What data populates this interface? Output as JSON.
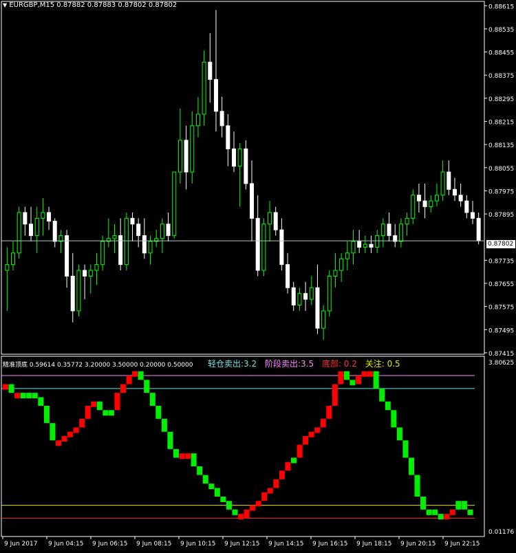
{
  "window": {
    "symbol_info": "EURGBP,M15  0.87882 0.87883 0.87802 0.87802",
    "menu_icon": "triangle-down-icon"
  },
  "colors": {
    "background": "#000000",
    "axis": "#ffffff",
    "bull": "#00ff00",
    "bear": "#ffffff",
    "last_price_line": "#a9c8c8",
    "ind_red": "#ff0000",
    "ind_green": "#00ee00",
    "level_pink": "#ff88ff",
    "level_cyan": "#6ee0e0",
    "level_yellow": "#e8e800",
    "level_red": "#ff3030"
  },
  "price_axis": {
    "labels": [
      "0.88615",
      "0.88535",
      "0.88455",
      "0.88375",
      "0.88295",
      "0.88215",
      "0.88135",
      "0.88055",
      "0.87975",
      "0.87895",
      "0.87802",
      "0.87735",
      "0.87655",
      "0.87575",
      "0.87495",
      "0.87415"
    ],
    "last_price": "0.87802",
    "range": [
      0.8741,
      0.8863
    ]
  },
  "time_axis": {
    "labels": [
      "9 Jun 2017",
      "9 Jun 04:15",
      "9 Jun 06:15",
      "9 Jun 08:15",
      "9 Jun 10:15",
      "9 Jun 12:15",
      "9 Jun 14:15",
      "9 Jun 16:15",
      "9 Jun 18:15",
      "9 Jun 20:15",
      "9 Jun 22:15"
    ]
  },
  "indicator": {
    "title": "精准顶底 0.59614 0.35772 3.20000 3.50000 0.20000 0.50000",
    "legend": [
      {
        "text": "轻仓卖出:3.2",
        "color": "#6ee0e0"
      },
      {
        "text": "阶段卖出:3.5",
        "color": "#ff88ff"
      },
      {
        "text": "底部: 0.2",
        "color": "#ff3030"
      },
      {
        "text": "关注: 0.5",
        "color": "#e8e800"
      }
    ],
    "axis_top": "3.80625",
    "axis_bottom": "0.01176",
    "levels": [
      3.5,
      3.2,
      0.5,
      0.2
    ],
    "range": [
      0.0,
      3.85
    ]
  },
  "chart_data": {
    "type": "candlestick",
    "symbol": "EURGBP",
    "timeframe": "M15",
    "candles": [
      [
        0.877,
        0.8778,
        0.8756,
        0.8772
      ],
      [
        0.8772,
        0.878,
        0.877,
        0.8776
      ],
      [
        0.8776,
        0.8792,
        0.8774,
        0.879
      ],
      [
        0.879,
        0.8792,
        0.8782,
        0.8786
      ],
      [
        0.8786,
        0.8792,
        0.878,
        0.8782
      ],
      [
        0.8782,
        0.8792,
        0.8776,
        0.8788
      ],
      [
        0.8788,
        0.8795,
        0.8782,
        0.879
      ],
      [
        0.879,
        0.8792,
        0.8784,
        0.8787
      ],
      [
        0.8787,
        0.8788,
        0.8778,
        0.878
      ],
      [
        0.878,
        0.8784,
        0.8776,
        0.8782
      ],
      [
        0.8782,
        0.8784,
        0.8764,
        0.8768
      ],
      [
        0.8768,
        0.8776,
        0.8752,
        0.8756
      ],
      [
        0.8756,
        0.8772,
        0.8754,
        0.877
      ],
      [
        0.877,
        0.8772,
        0.876,
        0.8768
      ],
      [
        0.8768,
        0.8772,
        0.8762,
        0.877
      ],
      [
        0.877,
        0.8776,
        0.8765,
        0.8772
      ],
      [
        0.8772,
        0.8782,
        0.877,
        0.878
      ],
      [
        0.878,
        0.8788,
        0.8778,
        0.8781
      ],
      [
        0.8781,
        0.8786,
        0.8776,
        0.8782
      ],
      [
        0.8782,
        0.8788,
        0.877,
        0.8772
      ],
      [
        0.8772,
        0.879,
        0.877,
        0.8788
      ],
      [
        0.8788,
        0.879,
        0.878,
        0.8786
      ],
      [
        0.8786,
        0.8788,
        0.8778,
        0.8782
      ],
      [
        0.8782,
        0.8788,
        0.8774,
        0.8776
      ],
      [
        0.8776,
        0.8782,
        0.8772,
        0.878
      ],
      [
        0.878,
        0.8784,
        0.8778,
        0.8781
      ],
      [
        0.8781,
        0.8788,
        0.8776,
        0.8786
      ],
      [
        0.8786,
        0.879,
        0.878,
        0.8782
      ],
      [
        0.8782,
        0.88,
        0.8781,
        0.8804
      ],
      [
        0.8804,
        0.8826,
        0.88,
        0.8815
      ],
      [
        0.8815,
        0.882,
        0.8798,
        0.8804
      ],
      [
        0.8804,
        0.8825,
        0.88,
        0.882
      ],
      [
        0.882,
        0.883,
        0.8816,
        0.8824
      ],
      [
        0.8824,
        0.8846,
        0.882,
        0.8842
      ],
      [
        0.8842,
        0.8852,
        0.8828,
        0.8836
      ],
      [
        0.8836,
        0.886,
        0.8818,
        0.8825
      ],
      [
        0.8825,
        0.883,
        0.8816,
        0.882
      ],
      [
        0.882,
        0.8824,
        0.8806,
        0.8812
      ],
      [
        0.8812,
        0.8818,
        0.8804,
        0.8806
      ],
      [
        0.8806,
        0.8814,
        0.8792,
        0.8812
      ],
      [
        0.8812,
        0.8815,
        0.8798,
        0.88
      ],
      [
        0.88,
        0.8808,
        0.878,
        0.8788
      ],
      [
        0.8788,
        0.8796,
        0.8768,
        0.877
      ],
      [
        0.877,
        0.8788,
        0.8768,
        0.8786
      ],
      [
        0.8786,
        0.8794,
        0.878,
        0.879
      ],
      [
        0.879,
        0.8792,
        0.8782,
        0.8784
      ],
      [
        0.8784,
        0.8788,
        0.877,
        0.8772
      ],
      [
        0.8772,
        0.8776,
        0.8762,
        0.8764
      ],
      [
        0.8764,
        0.8766,
        0.8756,
        0.8758
      ],
      [
        0.8758,
        0.8764,
        0.8756,
        0.8762
      ],
      [
        0.8762,
        0.8766,
        0.8756,
        0.876
      ],
      [
        0.876,
        0.8768,
        0.8758,
        0.8764
      ],
      [
        0.8764,
        0.8772,
        0.8748,
        0.875
      ],
      [
        0.875,
        0.8758,
        0.8746,
        0.8756
      ],
      [
        0.8756,
        0.877,
        0.8754,
        0.8768
      ],
      [
        0.8768,
        0.8776,
        0.8764,
        0.877
      ],
      [
        0.877,
        0.8776,
        0.8766,
        0.8774
      ],
      [
        0.8774,
        0.878,
        0.877,
        0.8776
      ],
      [
        0.8776,
        0.8784,
        0.8772,
        0.878
      ],
      [
        0.878,
        0.8784,
        0.8776,
        0.8778
      ],
      [
        0.8778,
        0.8782,
        0.8776,
        0.8779
      ],
      [
        0.8779,
        0.8782,
        0.8776,
        0.8778
      ],
      [
        0.8778,
        0.8784,
        0.8776,
        0.8782
      ],
      [
        0.8782,
        0.8788,
        0.8778,
        0.8786
      ],
      [
        0.8786,
        0.879,
        0.878,
        0.8782
      ],
      [
        0.8782,
        0.8786,
        0.8778,
        0.878
      ],
      [
        0.878,
        0.8788,
        0.8778,
        0.8786
      ],
      [
        0.8786,
        0.879,
        0.8782,
        0.8788
      ],
      [
        0.8788,
        0.8798,
        0.8786,
        0.8796
      ],
      [
        0.8796,
        0.88,
        0.879,
        0.8794
      ],
      [
        0.8794,
        0.88,
        0.8788,
        0.8792
      ],
      [
        0.8792,
        0.8796,
        0.879,
        0.8794
      ],
      [
        0.8794,
        0.88,
        0.8792,
        0.8796
      ],
      [
        0.8796,
        0.8808,
        0.8794,
        0.8804
      ],
      [
        0.8804,
        0.8808,
        0.8796,
        0.8798
      ],
      [
        0.8798,
        0.8802,
        0.8794,
        0.8796
      ],
      [
        0.8796,
        0.88,
        0.8792,
        0.8794
      ],
      [
        0.8794,
        0.8796,
        0.8788,
        0.879
      ],
      [
        0.879,
        0.8794,
        0.8786,
        0.8788
      ],
      [
        0.8788,
        0.879,
        0.8779,
        0.87802
      ]
    ]
  },
  "indicator_data": {
    "type": "histogram-steps",
    "values": [
      3.3,
      3.1,
      3.1,
      3.1,
      3.1,
      3.0,
      2.8,
      2.4,
      2.0,
      2.0,
      2.1,
      2.2,
      2.3,
      2.5,
      2.8,
      2.9,
      2.7,
      2.6,
      2.7,
      3.1,
      3.3,
      3.5,
      3.6,
      3.4,
      3.1,
      2.8,
      2.5,
      2.2,
      1.8,
      1.6,
      1.7,
      1.7,
      1.4,
      1.2,
      1.0,
      0.9,
      0.7,
      0.6,
      0.4,
      0.3,
      0.2,
      0.4,
      0.5,
      0.6,
      0.8,
      0.9,
      1.1,
      1.3,
      1.5,
      1.6,
      1.9,
      2.1,
      2.2,
      2.3,
      2.5,
      2.8,
      3.3,
      3.6,
      3.4,
      3.3,
      3.5,
      3.6,
      3.6,
      3.2,
      2.9,
      2.7,
      2.3,
      2.0,
      1.6,
      1.2,
      0.7,
      0.4,
      0.4,
      0.3,
      0.2,
      0.3,
      0.4,
      0.6,
      0.4,
      0.3
    ],
    "colors": [
      "r",
      "g",
      "r",
      "g",
      "g",
      "g",
      "g",
      "g",
      "g",
      "r",
      "r",
      "r",
      "r",
      "r",
      "r",
      "r",
      "g",
      "g",
      "g",
      "r",
      "r",
      "r",
      "r",
      "g",
      "g",
      "g",
      "g",
      "g",
      "g",
      "g",
      "r",
      "r",
      "g",
      "g",
      "g",
      "g",
      "g",
      "g",
      "g",
      "g",
      "r",
      "r",
      "r",
      "r",
      "r",
      "r",
      "r",
      "r",
      "r",
      "g",
      "r",
      "r",
      "r",
      "r",
      "r",
      "r",
      "r",
      "r",
      "g",
      "g",
      "r",
      "r",
      "r",
      "g",
      "g",
      "g",
      "g",
      "g",
      "g",
      "g",
      "g",
      "g",
      "g",
      "g",
      "g",
      "r",
      "r",
      "g",
      "g",
      "g"
    ]
  }
}
